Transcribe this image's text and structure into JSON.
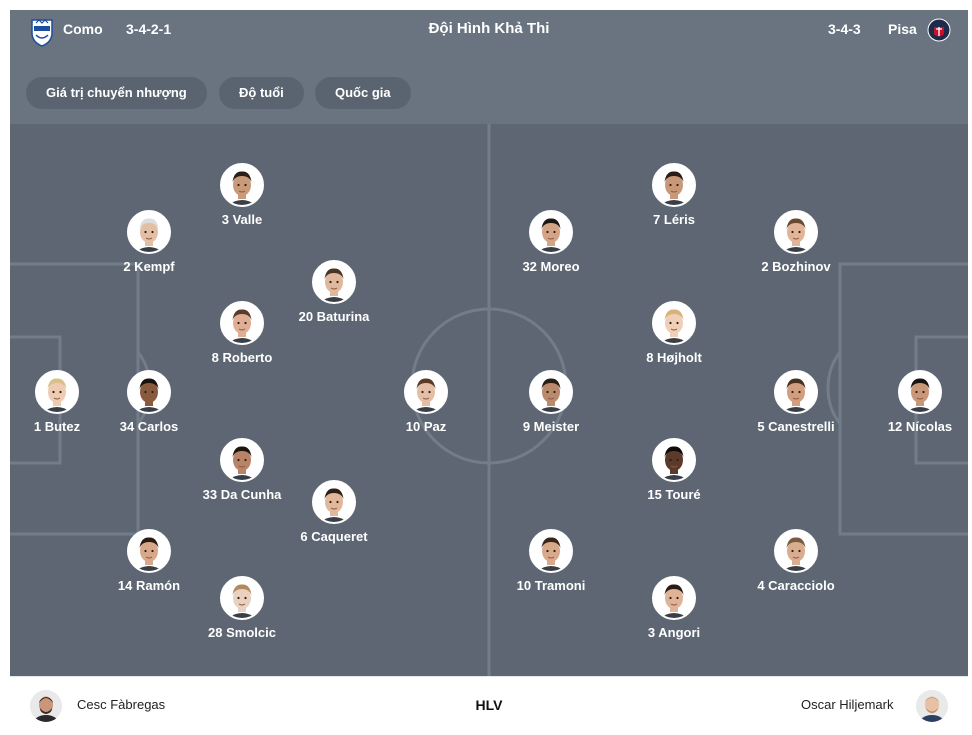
{
  "header": {
    "title": "Đội Hình Khả Thi",
    "home": {
      "name": "Como",
      "formation": "3-4-2-1",
      "logo_icon": "como-crest-icon"
    },
    "away": {
      "name": "Pisa",
      "formation": "3-4-3",
      "logo_icon": "pisa-crest-icon"
    }
  },
  "filters": [
    "Giá trị chuyển nhượng",
    "Độ tuổi",
    "Quốc gia"
  ],
  "colors": {
    "header_bg": "#697480",
    "pitch_bg": "#5d6672",
    "chip_bg": "#5a6470",
    "line": "#737d89"
  },
  "players": [
    {
      "label": "3 Valle",
      "skin": "#c99a7a",
      "hair": "#2b1e17"
    },
    {
      "label": "2 Kempf",
      "skin": "#e3bfa6",
      "hair": "#dddddd"
    },
    {
      "label": "20 Baturina",
      "skin": "#e0b89c",
      "hair": "#4a3426"
    },
    {
      "label": "8 Roberto",
      "skin": "#dfae95",
      "hair": "#5a3a2a"
    },
    {
      "label": "1 Butez",
      "skin": "#efcbb3",
      "hair": "#d9c08a"
    },
    {
      "label": "34 Carlos",
      "skin": "#8a5a3c",
      "hair": "#1a120d"
    },
    {
      "label": "10 Paz",
      "skin": "#e5bfa5",
      "hair": "#5b3b28"
    },
    {
      "label": "33 Da Cunha",
      "skin": "#b88366",
      "hair": "#1e1510"
    },
    {
      "label": "6 Caqueret",
      "skin": "#e2b89d",
      "hair": "#2e2018"
    },
    {
      "label": "14 Ramón",
      "skin": "#d7a88a",
      "hair": "#2a1c14"
    },
    {
      "label": "28 Smolcic",
      "skin": "#ead0bf",
      "hair": "#b38a60"
    },
    {
      "label": "7 Léris",
      "skin": "#c99878",
      "hair": "#2a1d16"
    },
    {
      "label": "32 Moreo",
      "skin": "#d4a487",
      "hair": "#1f1712"
    },
    {
      "label": "2 Bozhinov",
      "skin": "#e2b599",
      "hair": "#6b4a33"
    },
    {
      "label": "8 Højholt",
      "skin": "#f0cfb8",
      "hair": "#d8b27a"
    },
    {
      "label": "9 Meister",
      "skin": "#b98a6c",
      "hair": "#2a1d16"
    },
    {
      "label": "5 Canestrelli",
      "skin": "#d19f80",
      "hair": "#4a3020"
    },
    {
      "label": "12 Nícolas",
      "skin": "#c89878",
      "hair": "#1a1410"
    },
    {
      "label": "15 Touré",
      "skin": "#5b3a2a",
      "hair": "#0f0b09"
    },
    {
      "label": "10 Tramoni",
      "skin": "#d9a98b",
      "hair": "#3a271c"
    },
    {
      "label": "4 Caracciolo",
      "skin": "#d8ad90",
      "hair": "#7a5a40"
    },
    {
      "label": "3 Angori",
      "skin": "#e0b398",
      "hair": "#2a1c15"
    }
  ],
  "footer": {
    "home_coach": "Cesc Fàbregas",
    "center_label": "HLV",
    "away_coach": "Oscar Hiljemark"
  }
}
